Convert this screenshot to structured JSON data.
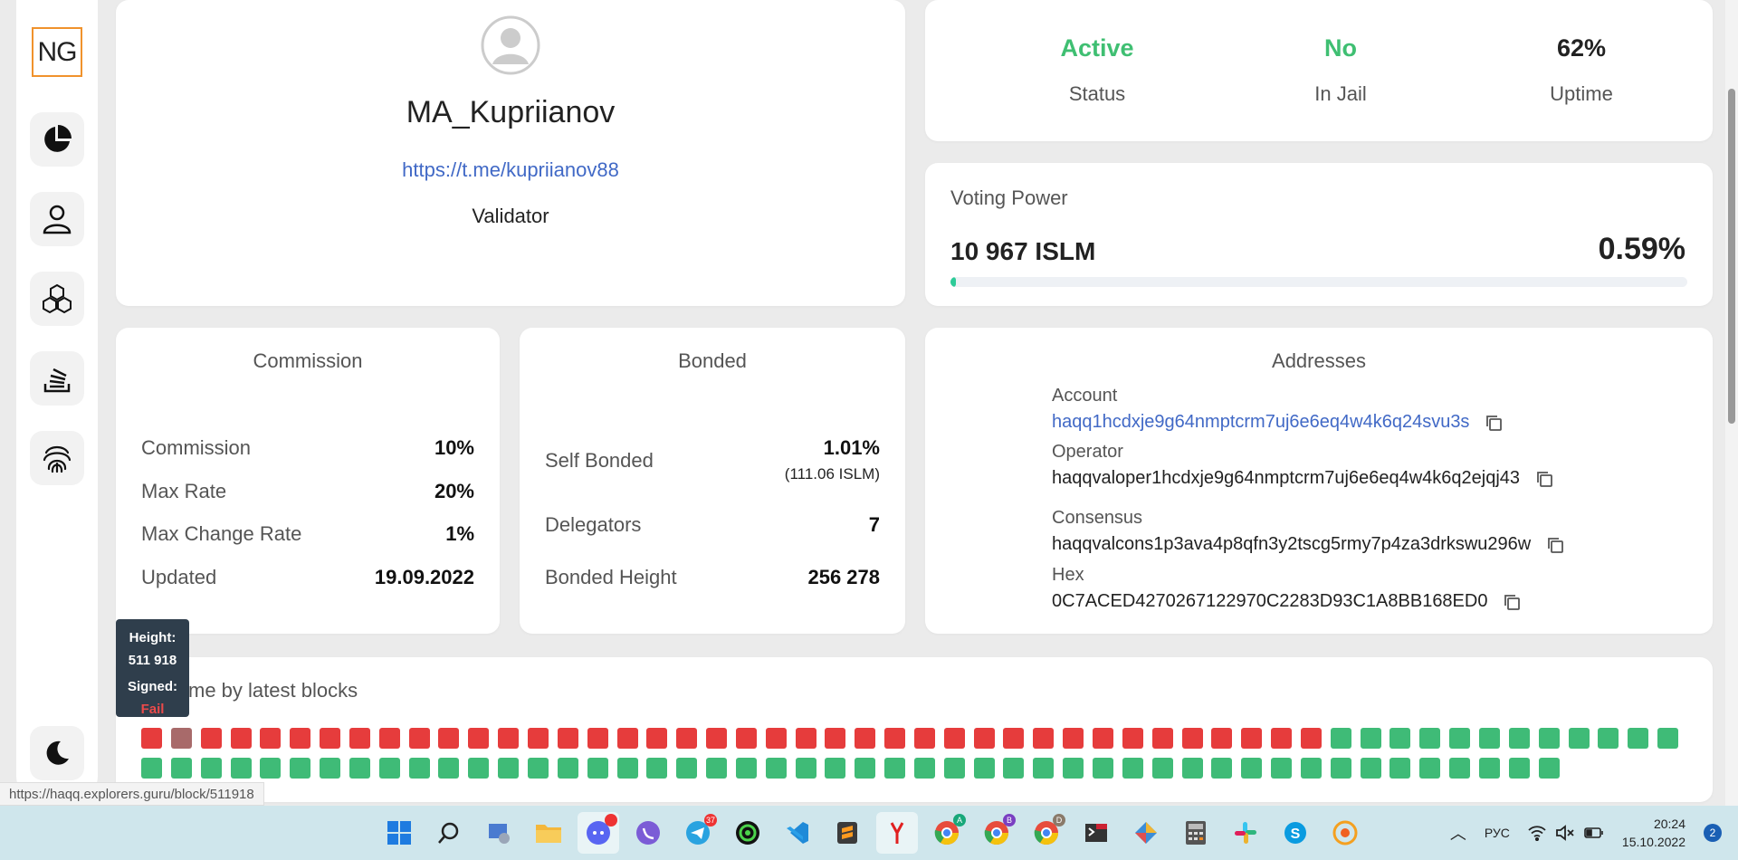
{
  "sidebar": {
    "logo": "NG",
    "items": [
      {
        "icon": "pie-chart-icon"
      },
      {
        "icon": "user-icon"
      },
      {
        "icon": "cubes-icon"
      },
      {
        "icon": "stack-icon"
      },
      {
        "icon": "fingerprint-icon"
      }
    ],
    "theme_icon": "moon-icon"
  },
  "profile": {
    "name": "MA_Kupriianov",
    "link": "https://t.me/kupriianov88",
    "role": "Validator"
  },
  "status": {
    "status_value": "Active",
    "status_label": "Status",
    "jail_value": "No",
    "jail_label": "In Jail",
    "uptime_value": "62%",
    "uptime_label": "Uptime",
    "green": "#3fbf72"
  },
  "voting_power": {
    "title": "Voting Power",
    "amount": "10 967 ISLM",
    "percent": "0.59%",
    "fraction": 0.0059
  },
  "commission": {
    "title": "Commission",
    "rows": [
      {
        "label": "Commission",
        "value": "10%"
      },
      {
        "label": "Max Rate",
        "value": "20%"
      },
      {
        "label": "Max Change Rate",
        "value": "1%"
      },
      {
        "label": "Updated",
        "value": "19.09.2022"
      }
    ]
  },
  "bonded": {
    "title": "Bonded",
    "self_label": "Self Bonded",
    "self_value": "1.01%",
    "self_sub": "(111.06 ISLM)",
    "delegators_label": "Delegators",
    "delegators_value": "7",
    "height_label": "Bonded Height",
    "height_value": "256 278"
  },
  "addresses": {
    "title": "Addresses",
    "items": [
      {
        "label": "Account",
        "value": "haqq1hcdxje9g64nmptcrm7uj6e6eq4w4k6q24svu3s",
        "link": true
      },
      {
        "label": "Operator",
        "value": "haqqvaloper1hcdxje9g64nmptcrm7uj6e6eq4w4k6q2ejqj43",
        "link": false
      },
      {
        "label": "Consensus",
        "value": "haqqvalcons1p3ava4p8qfn3y2tscg5rmy7p4za3drkswu296w",
        "link": false
      },
      {
        "label": "Hex",
        "value": "0C7ACED4270267122970C2283D93C1A8BB168ED0",
        "link": false
      }
    ]
  },
  "uptime": {
    "title_visible": "me by latest blocks",
    "blocks": [
      "fail",
      "hover",
      "fail",
      "fail",
      "fail",
      "fail",
      "fail",
      "fail",
      "fail",
      "fail",
      "fail",
      "fail",
      "fail",
      "fail",
      "fail",
      "fail",
      "fail",
      "fail",
      "fail",
      "fail",
      "fail",
      "fail",
      "fail",
      "fail",
      "fail",
      "fail",
      "fail",
      "fail",
      "fail",
      "fail",
      "fail",
      "fail",
      "fail",
      "fail",
      "fail",
      "fail",
      "fail",
      "fail",
      "fail",
      "fail",
      "ok",
      "ok",
      "ok",
      "ok",
      "ok",
      "ok",
      "ok",
      "ok",
      "ok",
      "ok",
      "ok",
      "ok",
      "ok",
      "ok",
      "ok",
      "ok",
      "ok",
      "ok",
      "ok",
      "ok",
      "ok",
      "ok",
      "ok",
      "ok",
      "ok",
      "ok",
      "ok",
      "ok",
      "ok",
      "ok",
      "ok",
      "ok",
      "ok",
      "ok",
      "ok",
      "ok",
      "ok",
      "ok",
      "ok",
      "ok",
      "ok",
      "ok",
      "ok",
      "ok",
      "ok",
      "ok",
      "ok",
      "ok",
      "ok",
      "ok",
      "ok",
      "ok",
      "ok",
      "ok",
      "ok",
      "ok",
      "ok",
      "ok",
      "ok",
      "ok"
    ],
    "colors": {
      "fail": "#e63c3c",
      "hover": "#a86a6a",
      "ok": "#3fbb77"
    }
  },
  "tooltip": {
    "height_label": "Height:",
    "height_value": "511 918",
    "signed_label": "Signed:",
    "signed_value": "Fail"
  },
  "statusbar_url": "https://haqq.explorers.guru/block/511918",
  "taskbar": {
    "icons": [
      "windows-start-icon",
      "search-icon",
      "control-panel-icon",
      "folder-icon",
      "discord-icon",
      "viber-icon",
      "telegram-icon",
      "xbox-icon",
      "vscode-icon",
      "sublime-icon",
      "yandex-icon",
      "chrome-a-icon",
      "chrome-b-icon",
      "chrome-d-icon",
      "terminal-icon",
      "gem-icon",
      "calculator-icon",
      "slack-icon",
      "skype-icon",
      "music-icon"
    ],
    "telegram_badge": "37",
    "chrome_a_badge": "A",
    "chrome_b_badge": "B",
    "chrome_d_badge": "D",
    "lang": "РУС",
    "time": "20:24",
    "date": "15.10.2022",
    "notifications": "2"
  }
}
